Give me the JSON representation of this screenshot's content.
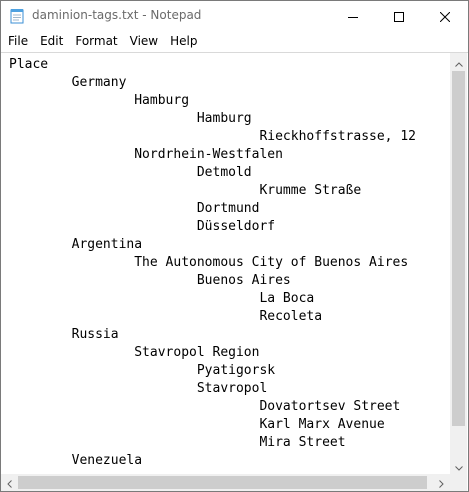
{
  "window": {
    "title": "daminion-tags.txt - Notepad"
  },
  "menu": {
    "items": [
      {
        "label": "File"
      },
      {
        "label": "Edit"
      },
      {
        "label": "Format"
      },
      {
        "label": "View"
      },
      {
        "label": "Help"
      }
    ]
  },
  "editor": {
    "content": "Place\n\tGermany\n\t\tHamburg\n\t\t\tHamburg\n\t\t\t\tRieckhoffstrasse, 12\n\t\tNordrhein-Westfalen\n\t\t\tDetmold\n\t\t\t\tKrumme Straße\n\t\t\tDortmund\n\t\t\tDüsseldorf\n\tArgentina\n\t\tThe Autonomous City of Buenos Aires\n\t\t\tBuenos Aires\n\t\t\t\tLa Boca\n\t\t\t\tRecoleta\n\tRussia\n\t\tStavropol Region\n\t\t\tPyatigorsk\n\t\t\tStavropol\n\t\t\t\tDovatortsev Street\n\t\t\t\tKarl Marx Avenue\n\t\t\t\tMira Street\n\tVenezuela"
  },
  "icons": {
    "app": "notepad-icon",
    "minimize": "minimize-icon",
    "maximize": "maximize-icon",
    "close": "close-icon",
    "scroll_up": "chevron-up-icon",
    "scroll_down": "chevron-down-icon",
    "scroll_left": "chevron-left-icon",
    "scroll_right": "chevron-right-icon"
  }
}
